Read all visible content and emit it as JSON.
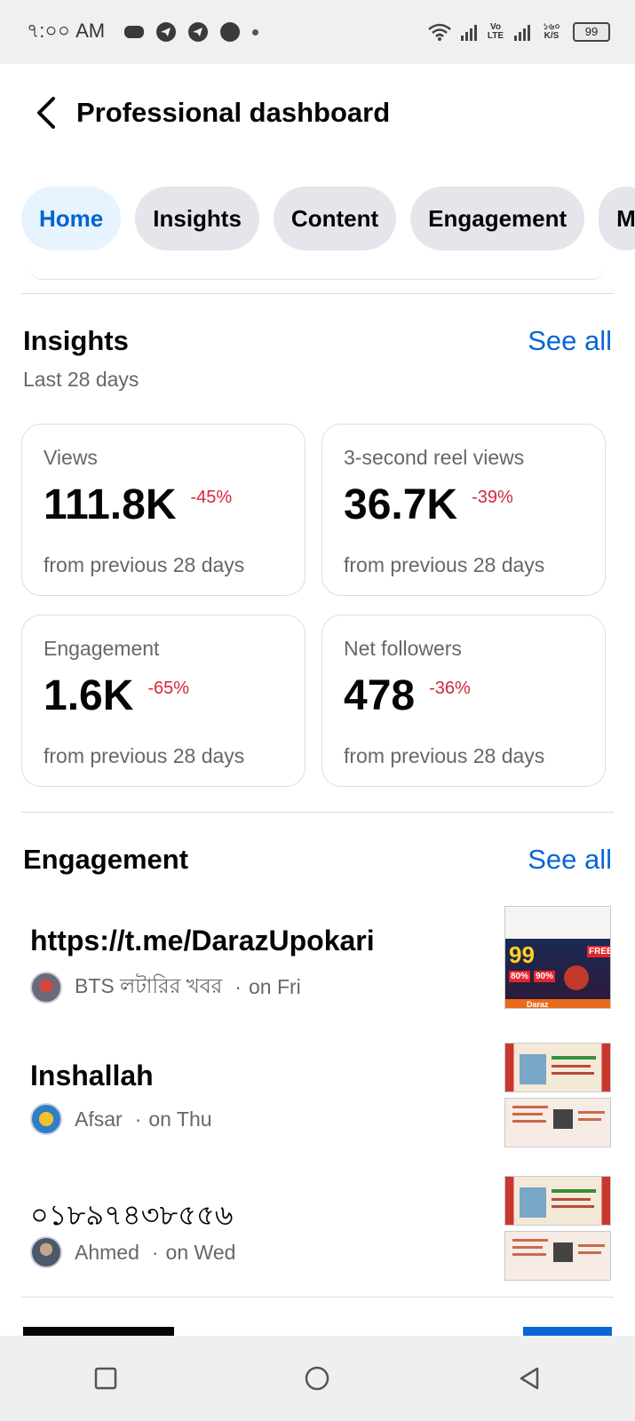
{
  "status_bar": {
    "time": "৭:০০ AM",
    "network_label": "Vo LTE",
    "speed_label": "১৬০ K/S",
    "battery": "99"
  },
  "header": {
    "title": "Professional dashboard"
  },
  "tabs": [
    {
      "label": "Home",
      "active": true
    },
    {
      "label": "Insights",
      "active": false
    },
    {
      "label": "Content",
      "active": false
    },
    {
      "label": "Engagement",
      "active": false
    },
    {
      "label": "M",
      "active": false
    }
  ],
  "insights": {
    "title": "Insights",
    "subtitle": "Last 28 days",
    "see_all": "See all",
    "cards": [
      {
        "label": "Views",
        "value": "111.8K",
        "change": "-45%",
        "footnote": "from previous 28 days"
      },
      {
        "label": "3-second reel views",
        "value": "36.7K",
        "change": "-39%",
        "footnote": "from previous 28 days"
      },
      {
        "label": "Engagement",
        "value": "1.6K",
        "change": "-65%",
        "footnote": "from previous 28 days"
      },
      {
        "label": "Net followers",
        "value": "478",
        "change": "-36%",
        "footnote": "from previous 28 days"
      }
    ]
  },
  "engagement": {
    "title": "Engagement",
    "see_all": "See all",
    "posts": [
      {
        "title": "https://t.me/DarazUpokari",
        "author": "BTS লটারির খবর",
        "when": "on Fri"
      },
      {
        "title": "Inshallah",
        "author": "Afsar",
        "when": "on Thu"
      },
      {
        "title": "০১৮৯৭৪৩৮৫৫৬",
        "author": "Ahmed",
        "when": "on Wed"
      }
    ]
  },
  "thumb_text": {
    "price": "99",
    "free": "FREE",
    "pct1": "80%",
    "pct2": "90%",
    "brand": "Daraz"
  },
  "colors": {
    "accent": "#0866d6",
    "negative": "#d3283a",
    "tab_active_bg": "#e7f3ff",
    "tab_bg": "#e4e6eb"
  }
}
